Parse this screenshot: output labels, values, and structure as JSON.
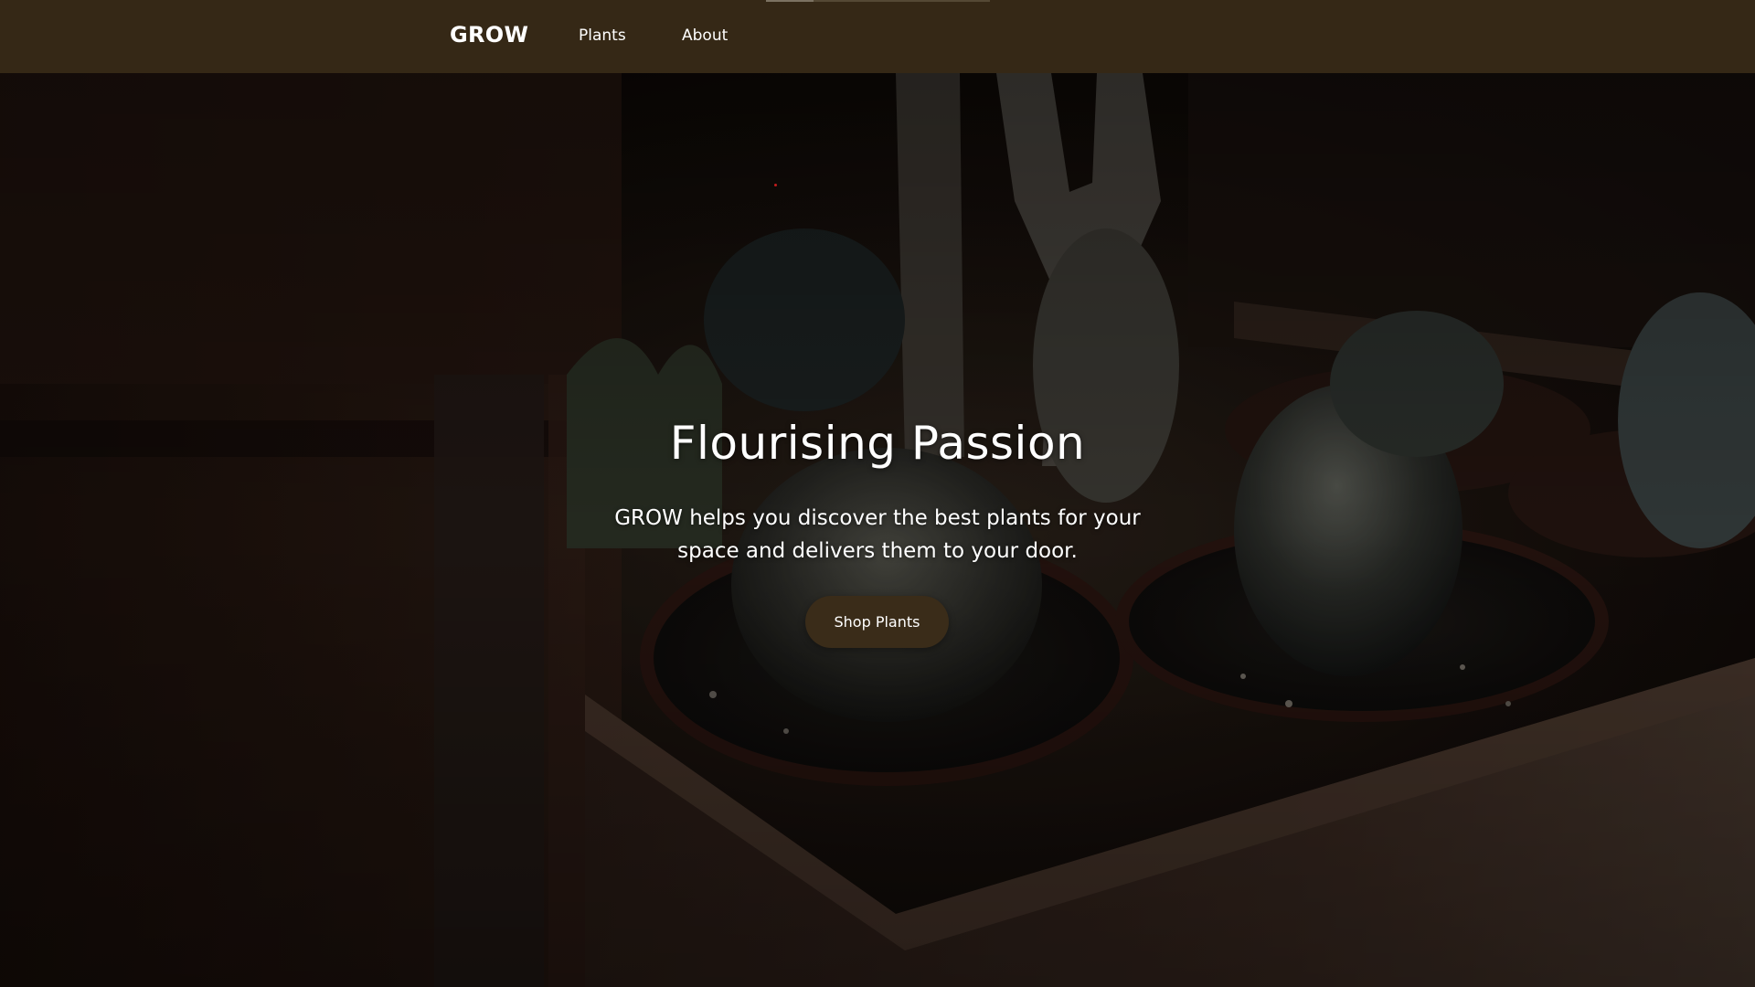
{
  "nav": {
    "brand": "GROW",
    "links": [
      {
        "label": "Plants"
      },
      {
        "label": "About"
      }
    ]
  },
  "hero": {
    "title": "Flourising Passion",
    "subtitle": "GROW helps you discover the best plants for your space and delivers them to your door.",
    "cta_label": "Shop Plants"
  },
  "colors": {
    "nav_background": "#352816",
    "button_background": "#3a2c19",
    "text": "#ffffff"
  },
  "icons": {
    "hero_image": "cactus-pots-photo"
  }
}
